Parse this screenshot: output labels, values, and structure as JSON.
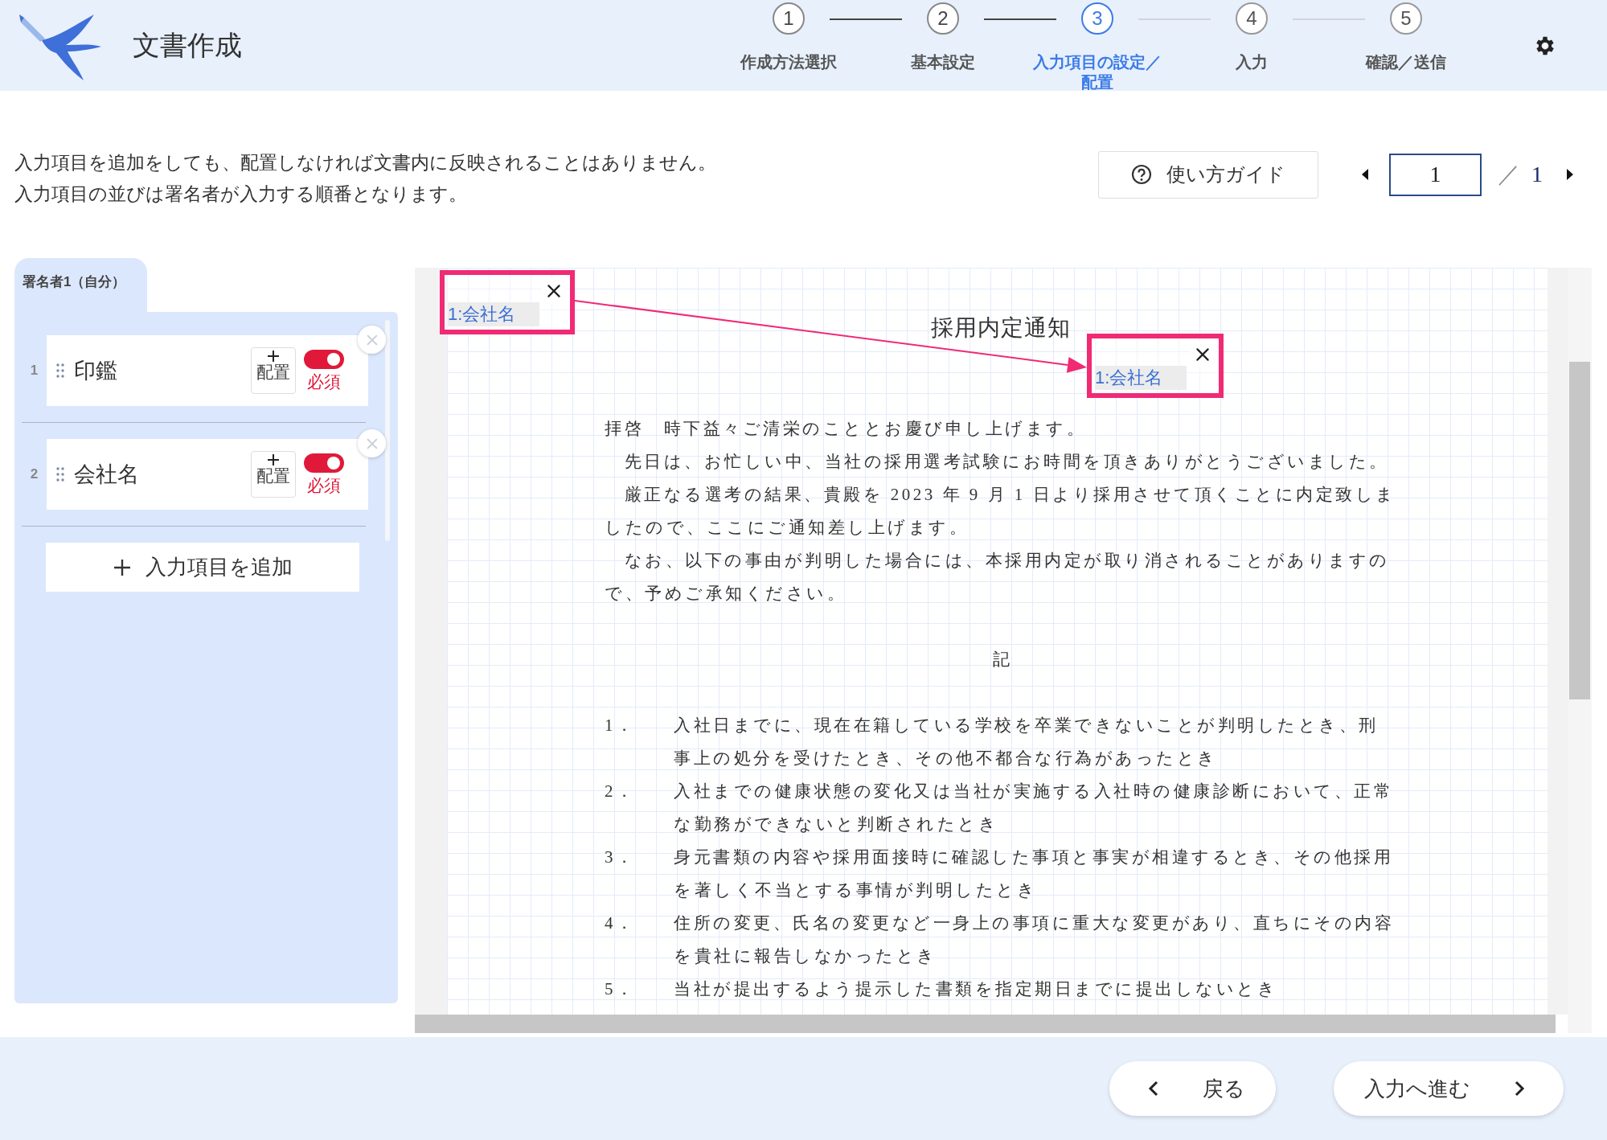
{
  "header": {
    "title": "文書作成",
    "steps": [
      {
        "number": "1",
        "label": "作成方法選択",
        "selected": false,
        "completed": true
      },
      {
        "number": "2",
        "label": "基本設定",
        "selected": false,
        "completed": true
      },
      {
        "number": "3",
        "label": "入力項目の設定／配置",
        "selected": true,
        "completed": false
      },
      {
        "number": "4",
        "label": "入力",
        "selected": false,
        "completed": false
      },
      {
        "number": "5",
        "label": "確認／送信",
        "selected": false,
        "completed": false
      }
    ]
  },
  "instructions": [
    "入力項目を追加をしても、配置しなければ文書内に反映されることはありません。",
    "入力項目の並びは署名者が入力する順番となります。"
  ],
  "guide_button": {
    "label": "使い方ガイド"
  },
  "pager": {
    "value": "1",
    "separator": "／",
    "total": "1"
  },
  "signer_tabs": [
    {
      "label": "署名者1（自分）",
      "selected": true
    }
  ],
  "fields": [
    {
      "number": "1",
      "name": "印鑑",
      "place_label": "配置",
      "required": true,
      "required_label": "必須"
    },
    {
      "number": "2",
      "name": "会社名",
      "place_label": "配置",
      "required": true,
      "required_label": "必須"
    }
  ],
  "add_button": {
    "label": "入力項目を追加"
  },
  "document": {
    "title": "採用内定通知",
    "paragraphs": [
      "拝啓　時下益々ご清栄のこととお慶び申し上げます。",
      "　先日は、お忙しい中、当社の採用選考試験にお時間を頂きありがとうございました。",
      "　厳正なる選考の結果、貴殿を 2023 年 9 月 1 日より採用させて頂くことに内定致しましたので、ここにご通知差し上げます。",
      "　なお、以下の事由が判明した場合には、本採用内定が取り消されることがありますので、予めご承知ください。"
    ],
    "center_heading": "記",
    "list": [
      {
        "number": "1．",
        "text": "入社日までに、現在在籍している学校を卒業できないことが判明したとき、刑事上の処分を受けたとき、その他不都合な行為があったとき"
      },
      {
        "number": "2．",
        "text": "入社までの健康状態の変化又は当社が実施する入社時の健康診断において、正常な勤務ができないと判断されたとき"
      },
      {
        "number": "3．",
        "text": "身元書類の内容や採用面接時に確認した事項と事実が相違するとき、その他採用を著しく不当とする事情が判明したとき"
      },
      {
        "number": "4．",
        "text": "住所の変更、氏名の変更など一身上の事項に重大な変更があり、直ちにその内容を貴社に報告しなかったとき"
      },
      {
        "number": "5．",
        "text": "当社が提出するよう提示した書類を指定期日までに提出しないとき"
      }
    ]
  },
  "placed_fields": [
    {
      "label": "1:会社名",
      "kind": "source"
    },
    {
      "label": "1:会社名",
      "kind": "target"
    }
  ],
  "footer": {
    "back": "戻る",
    "next": "入力へ進む"
  }
}
